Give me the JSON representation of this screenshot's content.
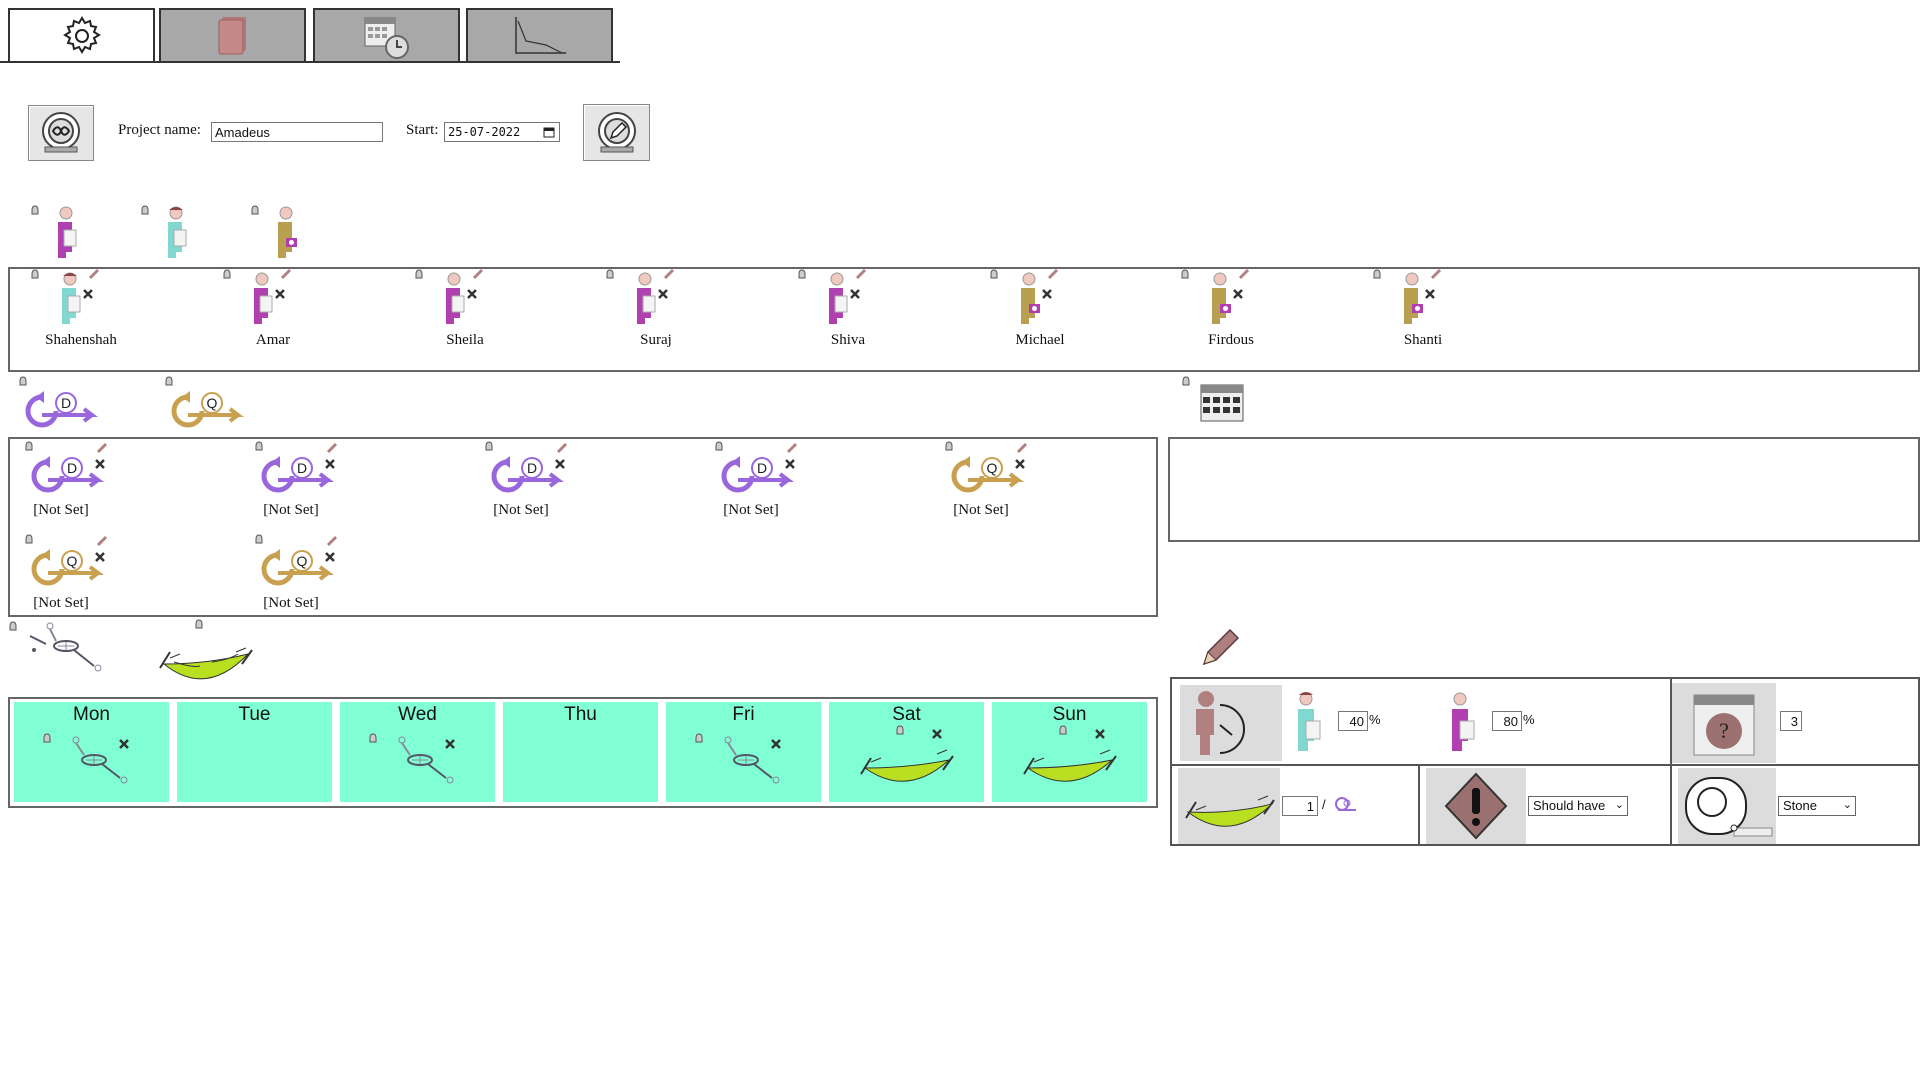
{
  "tabs": [
    {
      "icon": "gear-icon",
      "active": true
    },
    {
      "icon": "document-stack-icon",
      "active": false
    },
    {
      "icon": "calendar-clock-icon",
      "active": false
    },
    {
      "icon": "line-chart-icon",
      "active": false
    }
  ],
  "header": {
    "project_label": "Project name:",
    "project_value": "Amadeus",
    "start_label": "Start:",
    "start_value": "25-07-2022"
  },
  "team": {
    "members": [
      {
        "name": "Shahenshah",
        "role": "dev-cap"
      },
      {
        "name": "Amar",
        "role": "dev"
      },
      {
        "name": "Sheila",
        "role": "dev"
      },
      {
        "name": "Suraj",
        "role": "dev"
      },
      {
        "name": "Shiva",
        "role": "dev"
      },
      {
        "name": "Michael",
        "role": "photo"
      },
      {
        "name": "Firdous",
        "role": "photo"
      },
      {
        "name": "Shanti",
        "role": "photo"
      }
    ]
  },
  "sprints": {
    "items": [
      {
        "type": "D",
        "label": "[Not Set]"
      },
      {
        "type": "D",
        "label": "[Not Set]"
      },
      {
        "type": "D",
        "label": "[Not Set]"
      },
      {
        "type": "D",
        "label": "[Not Set]"
      },
      {
        "type": "Q",
        "label": "[Not Set]"
      },
      {
        "type": "Q",
        "label": "[Not Set]"
      },
      {
        "type": "Q",
        "label": "[Not Set]"
      }
    ]
  },
  "calendar": {
    "days": [
      {
        "label": "Mon",
        "kind": "work"
      },
      {
        "label": "Tue",
        "kind": "none"
      },
      {
        "label": "Wed",
        "kind": "work"
      },
      {
        "label": "Thu",
        "kind": "none"
      },
      {
        "label": "Fri",
        "kind": "work"
      },
      {
        "label": "Sat",
        "kind": "rest"
      },
      {
        "label": "Sun",
        "kind": "rest"
      }
    ]
  },
  "settings": {
    "alloc_1": "40",
    "alloc_2": "80",
    "pct_symbol": "%",
    "days_value": "3",
    "rest_value": "1",
    "separator": "/",
    "priority": "Should have",
    "measure": "Stone"
  },
  "colors": {
    "day_bg": "#80ffd4",
    "purple_sprint": "#9966dd",
    "gold_sprint": "#c8a050",
    "hammock": "#b8e020"
  }
}
